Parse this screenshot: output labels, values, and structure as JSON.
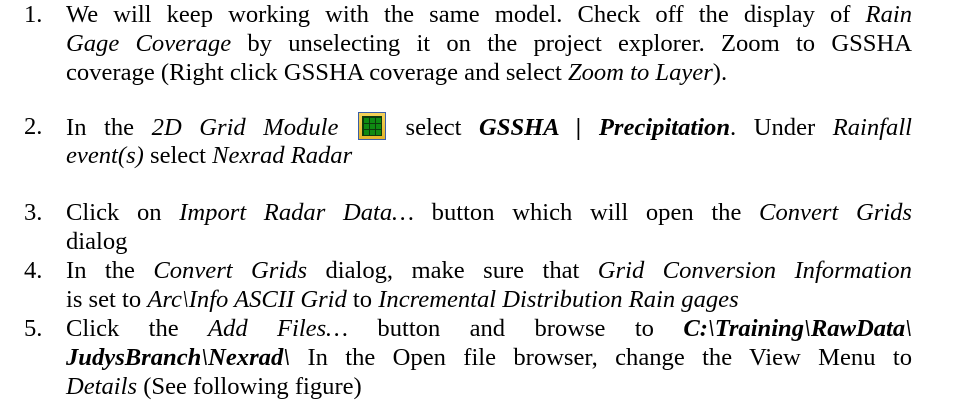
{
  "steps": [
    {
      "number": "1.",
      "l1_a": "We will keep working with the same model. Check off the display of ",
      "l1_b": "Rain",
      "l2_a": "Gage Coverage",
      "l2_b": " by unselecting it on the project explorer. Zoom to GSSHA",
      "l3_a": "coverage (Right click GSSHA coverage and select ",
      "l3_b": "Zoom to Layer",
      "l3_c": ")."
    },
    {
      "number": "2.",
      "l1_a": "In the ",
      "l1_b": "2D Grid Module",
      "l1_c": " select ",
      "l1_d": "GSSHA | Precipitation",
      "l1_e": ". Under ",
      "l1_f": "Rainfall",
      "l2_a": "event(s)",
      "l2_b": " select ",
      "l2_c": "Nexrad Radar",
      "icon": "2d-grid-module-icon"
    },
    {
      "number": "3.",
      "l1_a": "Click on ",
      "l1_b": "Import Radar Data…",
      "l1_c": " button which will open the ",
      "l1_d": "Convert Grids",
      "l2_a": "dialog"
    },
    {
      "number": "4.",
      "l1_a": "In the ",
      "l1_b": "Convert Grids",
      "l1_c": " dialog, make sure that ",
      "l1_d": "Grid Conversion Information",
      "l2_a": "is set to ",
      "l2_b": "Arc\\Info ASCII Grid",
      "l2_c": " to ",
      "l2_d": "Incremental Distribution Rain gages"
    },
    {
      "number": "5.",
      "l1_a": "Click the ",
      "l1_b": "Add Files…",
      "l1_c": " button and browse to ",
      "l1_d": "C:\\Training\\RawData\\",
      "l2_a": "JudysBranch\\Nexrad\\",
      "l2_b": " In the Open file browser, change the View Menu to",
      "l3_a": "Details",
      "l3_b": " (See following figure)"
    }
  ]
}
